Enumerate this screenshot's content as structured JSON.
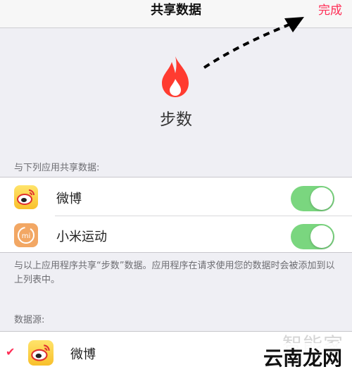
{
  "nav": {
    "title": "共享数据",
    "done_label": "完成"
  },
  "hero": {
    "title": "步数",
    "icon": "flame-icon",
    "accent_color": "#ff3b30"
  },
  "share_section": {
    "header": "与下列应用共享数据:",
    "apps": [
      {
        "label": "微博",
        "icon": "weibo-icon",
        "enabled": true
      },
      {
        "label": "小米运动",
        "icon": "mi-fit-icon",
        "icon_text": "mi",
        "enabled": true
      }
    ],
    "footer": "与以上应用程序共享“步数”数据。应用程序在请求使用您的数据时会被添加到以上列表中。"
  },
  "source_section": {
    "header": "数据源:",
    "items": [
      {
        "label": "微博",
        "checked": true,
        "icon": "weibo-icon"
      }
    ]
  },
  "watermark": {
    "line1": "智能家",
    "line2": "云南龙网"
  },
  "colors": {
    "toggle_on": "#7ad67f",
    "tint": "#ff2d55",
    "background": "#efeff4"
  }
}
